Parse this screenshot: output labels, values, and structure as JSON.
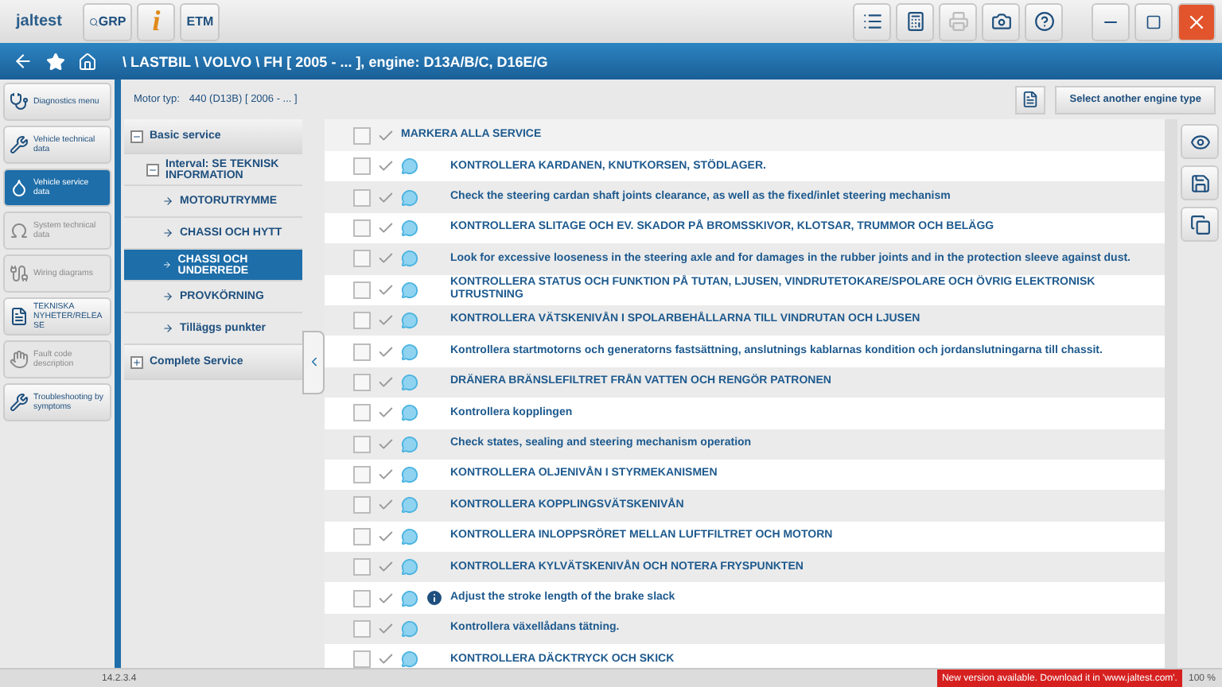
{
  "app": {
    "logo": "jaltest",
    "tools": [
      {
        "kind": "grp",
        "label": "GRP"
      },
      {
        "kind": "info",
        "label": "i"
      },
      {
        "kind": "etm",
        "label": "ETM"
      }
    ]
  },
  "toolbar_right": [
    {
      "kind": "list",
      "disabled": false
    },
    {
      "kind": "calc",
      "disabled": false
    },
    {
      "kind": "print",
      "disabled": true
    },
    {
      "kind": "camera",
      "disabled": false
    },
    {
      "kind": "help",
      "disabled": false
    }
  ],
  "breadcrumb": "\\ LASTBIL \\ VOLVO \\ FH [ 2005 - ... ], engine: D13A/B/C, D16E/G",
  "sidebar": {
    "items": [
      {
        "label": "Diagnostics menu",
        "kind": "diag",
        "selected": false,
        "disabled": false
      },
      {
        "label": "Vehicle technical data",
        "kind": "wrench",
        "selected": false,
        "disabled": false
      },
      {
        "label": "Vehicle service data",
        "kind": "oil",
        "selected": true,
        "disabled": false
      },
      {
        "label": "System technical data",
        "kind": "omega",
        "selected": false,
        "disabled": true
      },
      {
        "label": "Wiring diagrams",
        "kind": "wire",
        "selected": false,
        "disabled": true
      },
      {
        "label": "TEKNISKA NYHETER/RELEASE",
        "kind": "doc",
        "selected": false,
        "disabled": false
      },
      {
        "label": "Fault code description",
        "kind": "hand",
        "selected": false,
        "disabled": true
      },
      {
        "label": "Troubleshooting by symptoms",
        "kind": "trouble",
        "selected": false,
        "disabled": false
      }
    ]
  },
  "engine": {
    "label": "Motor typ:",
    "value": "440 (D13B) [ 2006 - ... ]",
    "button": "Select another engine type"
  },
  "tree": [
    {
      "label": "Basic service",
      "expanded": true,
      "selected": false,
      "children": [
        {
          "label": "Interval: SE TEKNISK INFORMATION",
          "expanded": true,
          "selected": false,
          "children": [
            {
              "label": "MOTORUTRYMME",
              "selected": false
            },
            {
              "label": "CHASSI OCH HYTT",
              "selected": false
            },
            {
              "label": "CHASSI OCH UNDERREDE",
              "selected": true
            },
            {
              "label": "PROVKÖRNING",
              "selected": false
            },
            {
              "label": "Tilläggs punkter",
              "selected": false
            }
          ]
        }
      ]
    },
    {
      "label": "Complete Service",
      "expanded": false,
      "selected": false
    }
  ],
  "select_all": {
    "label": "MARKERA ALLA SERVICE",
    "checked": false
  },
  "tasks": [
    {
      "text": "KONTROLLERA KARDANEN, KNUTKORSEN, STÖDLAGER.",
      "checked": false,
      "info": false
    },
    {
      "text": "Check the steering cardan shaft joints clearance, as well as the fixed/inlet steering mechanism",
      "checked": false,
      "info": false
    },
    {
      "text": "KONTROLLERA SLITAGE OCH EV. SKADOR PÅ BROMSSKIVOR, KLOTSAR, TRUMMOR OCH BELÄGG",
      "checked": false,
      "info": false
    },
    {
      "text": "Look for excessive looseness in the steering axle and for damages in the rubber joints and in the protection sleeve against dust.",
      "checked": false,
      "info": false
    },
    {
      "text": "KONTROLLERA STATUS OCH FUNKTION PÅ TUTAN, LJUSEN, VINDRUTETOKARE/SPOLARE OCH ÖVRIG ELEKTRONISK UTRUSTNING",
      "checked": false,
      "info": false
    },
    {
      "text": "KONTROLLERA VÄTSKENIVÅN I SPOLARBEHÅLLARNA TILL VINDRUTAN OCH LJUSEN",
      "checked": false,
      "info": false
    },
    {
      "text": "Kontrollera startmotorns och generatorns fastsättning, anslutnings kablarnas kondition och jordanslutningarna till chassit.",
      "checked": false,
      "info": false
    },
    {
      "text": "DRÄNERA BRÄNSLEFILTRET FRÅN VATTEN OCH RENGÖR PATRONEN",
      "checked": false,
      "info": false
    },
    {
      "text": "Kontrollera kopplingen",
      "checked": false,
      "info": false
    },
    {
      "text": "Check states, sealing and steering mechanism operation",
      "checked": false,
      "info": false
    },
    {
      "text": "KONTROLLERA OLJENIVÅN I STYRMEKANISMEN",
      "checked": false,
      "info": false
    },
    {
      "text": "KONTROLLERA KOPPLINGSVÄTSKENIVÅN",
      "checked": false,
      "info": false
    },
    {
      "text": "KONTROLLERA INLOPPSRÖRET MELLAN LUFTFILTRET OCH MOTORN",
      "checked": false,
      "info": false
    },
    {
      "text": "KONTROLLERA KYLVÄTSKENIVÅN OCH NOTERA FRYSPUNKTEN",
      "checked": false,
      "info": false
    },
    {
      "text": "Adjust the stroke length of the brake slack",
      "checked": false,
      "info": true
    },
    {
      "text": "Kontrollera växellådans tätning.",
      "checked": false,
      "info": false
    },
    {
      "text": "KONTROLLERA DÄCKTRYCK OCH SKICK",
      "checked": false,
      "info": false
    }
  ],
  "side_tools": [
    {
      "kind": "eye"
    },
    {
      "kind": "save"
    },
    {
      "kind": "copy"
    }
  ],
  "status_bar": {
    "version": "14.2.3.4",
    "notice": "New version available. Download it in 'www.jaltest.com'.",
    "zoom": "100 %"
  }
}
